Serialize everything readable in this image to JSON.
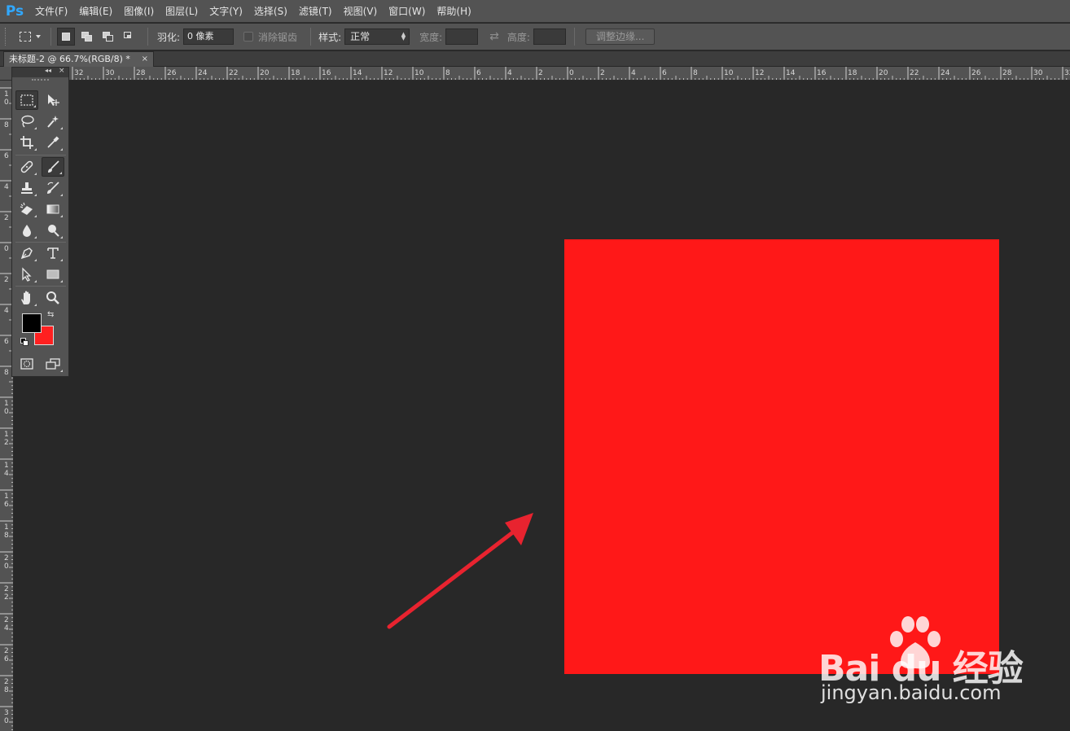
{
  "app": {
    "logo": "Ps",
    "logo_color": "#31a8ff"
  },
  "menu": [
    "文件(F)",
    "编辑(E)",
    "图像(I)",
    "图层(L)",
    "文字(Y)",
    "选择(S)",
    "滤镜(T)",
    "视图(V)",
    "窗口(W)",
    "帮助(H)"
  ],
  "options": {
    "feather_label": "羽化:",
    "feather_value": "0 像素",
    "antialias_label": "消除锯齿",
    "style_label": "样式:",
    "style_value": "正常",
    "width_label": "宽度:",
    "height_label": "高度:",
    "refine_edge_button": "调整边缘..."
  },
  "document_tab": {
    "title": "未标题-2 @ 66.7%(RGB/8) *",
    "close": "×"
  },
  "ruler_h_labels": [
    "32",
    "30",
    "28",
    "26",
    "24",
    "22",
    "20",
    "18",
    "16",
    "14",
    "12",
    "10",
    "8",
    "6",
    "4",
    "2",
    "0",
    "2",
    "4",
    "6",
    "8",
    "10",
    "12",
    "14",
    "16",
    "18",
    "20",
    "22",
    "24",
    "26",
    "28",
    "30",
    "32"
  ],
  "ruler_v_labels": [
    "1\n0",
    "8",
    "6",
    "4",
    "2",
    "0",
    "2",
    "4",
    "6",
    "8",
    "1\n0",
    "1\n2",
    "1\n4",
    "1\n6",
    "1\n8",
    "2\n0",
    "2\n2",
    "2\n4",
    "2\n6",
    "2\n8",
    "3\n0"
  ],
  "tools_panel": {
    "collapse": "◂◂",
    "close": "×"
  },
  "tools": [
    {
      "name": "rectangular-marquee-icon",
      "active": true
    },
    {
      "name": "move-icon"
    },
    {
      "name": "lasso-icon"
    },
    {
      "name": "magic-wand-icon"
    },
    {
      "name": "crop-icon"
    },
    {
      "name": "eyedropper-icon"
    },
    {
      "name": "healing-brush-icon"
    },
    {
      "name": "brush-icon",
      "active": true
    },
    {
      "name": "clone-stamp-icon"
    },
    {
      "name": "history-brush-icon"
    },
    {
      "name": "eraser-icon"
    },
    {
      "name": "gradient-icon"
    },
    {
      "name": "blur-icon"
    },
    {
      "name": "dodge-icon"
    },
    {
      "name": "pen-icon"
    },
    {
      "name": "type-icon"
    },
    {
      "name": "path-selection-icon"
    },
    {
      "name": "rectangle-shape-icon"
    },
    {
      "name": "hand-icon"
    },
    {
      "name": "zoom-icon"
    }
  ],
  "colors": {
    "foreground": "#000000",
    "background": "#ff2020",
    "document_fill": "#ff1818",
    "arrow": "#e8232f"
  },
  "watermark": {
    "brand": "Bai du 经验",
    "url": "jingyan.baidu.com"
  }
}
